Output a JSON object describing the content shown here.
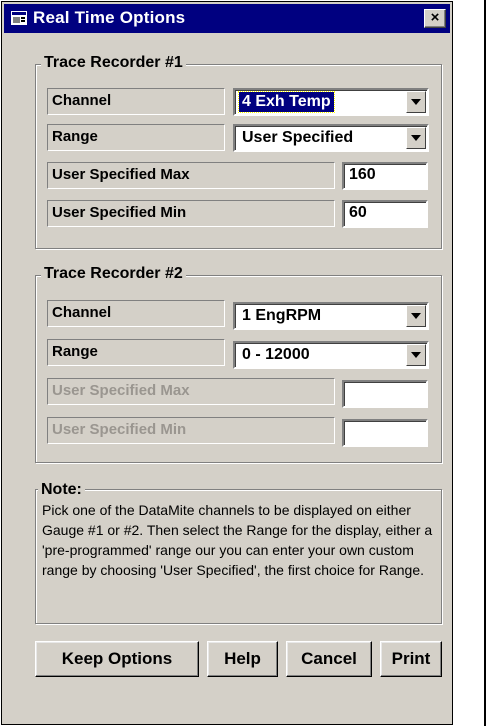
{
  "window": {
    "title": "Real Time Options",
    "close_label": "×",
    "icon": "window-app-icon"
  },
  "recorder1": {
    "legend": "Trace Recorder #1",
    "channel_label": "Channel",
    "channel_value": "4 Exh Temp",
    "range_label": "Range",
    "range_value": "User Specified",
    "max_label": "User Specified Max",
    "max_value": "160",
    "min_label": "User Specified Min",
    "min_value": "60"
  },
  "recorder2": {
    "legend": "Trace Recorder #2",
    "channel_label": "Channel",
    "channel_value": "1 EngRPM",
    "range_label": "Range",
    "range_value": "0 - 12000",
    "max_label": "User Specified Max",
    "max_value": "",
    "min_label": "User Specified Min",
    "min_value": ""
  },
  "note": {
    "legend": "Note:",
    "text": "Pick one of the DataMite channels to be displayed on either Gauge #1 or #2.  Then select the Range for the display, either a 'pre-programmed' range our you can enter your own custom range by choosing 'User Specified', the first choice for Range."
  },
  "buttons": {
    "keep": "Keep Options",
    "help": "Help",
    "cancel": "Cancel",
    "print": "Print"
  }
}
